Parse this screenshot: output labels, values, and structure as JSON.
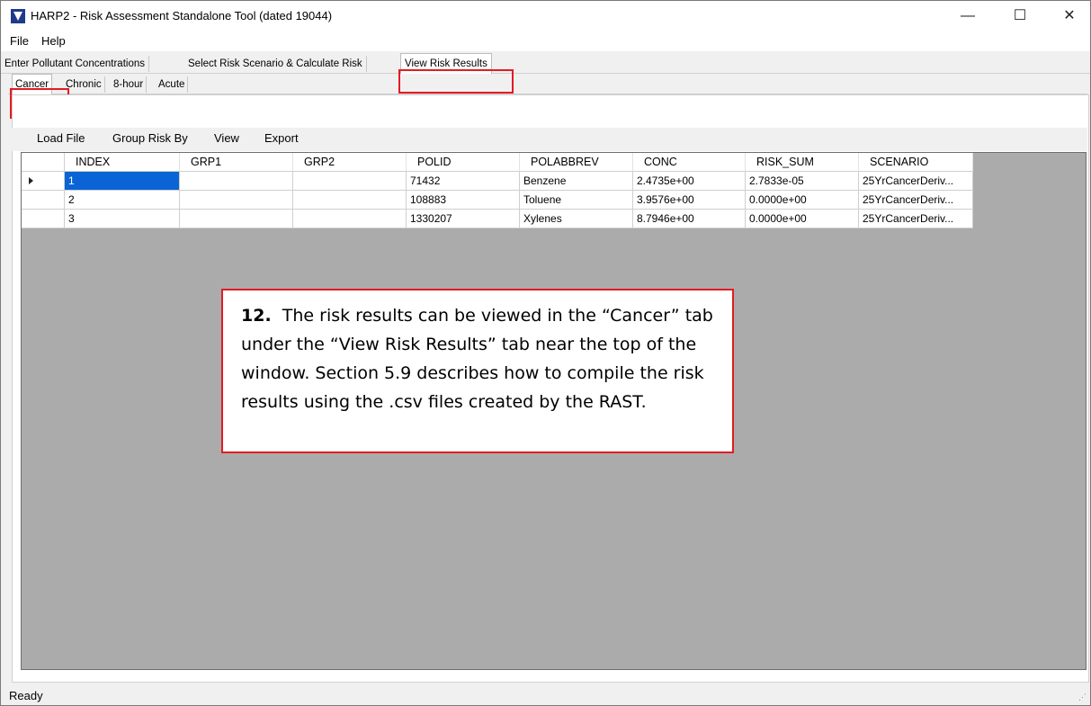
{
  "window": {
    "title": "HARP2 - Risk Assessment Standalone Tool (dated 19044)",
    "minimize_glyph": "—",
    "maximize_glyph": "☐",
    "close_glyph": "✕"
  },
  "menu": {
    "file": "File",
    "help": "Help"
  },
  "main_tabs": [
    "Enter Pollutant Concentrations",
    "Select Risk Scenario & Calculate Risk",
    "View Risk Results"
  ],
  "sub_tabs": [
    "Cancer",
    "Chronic",
    "8-hour",
    "Acute"
  ],
  "toolbar": {
    "load_file": "Load File",
    "group_risk_by": "Group Risk By",
    "view": "View",
    "export": "Export"
  },
  "table": {
    "columns": [
      "INDEX",
      "GRP1",
      "GRP2",
      "POLID",
      "POLABBREV",
      "CONC",
      "RISK_SUM",
      "SCENARIO"
    ],
    "rows": [
      [
        "1",
        "",
        "",
        "71432",
        "Benzene",
        "2.4735e+00",
        "2.7833e-05",
        "25YrCancerDeriv..."
      ],
      [
        "2",
        "",
        "",
        "108883",
        "Toluene",
        "3.9576e+00",
        "0.0000e+00",
        "25YrCancerDeriv..."
      ],
      [
        "3",
        "",
        "",
        "1330207",
        "Xylenes",
        "8.7946e+00",
        "0.0000e+00",
        "25YrCancerDeriv..."
      ]
    ]
  },
  "callout": {
    "number": "12.",
    "text": "The risk results can be viewed in the “Cancer” tab under the “View Risk Results” tab near the top of the window.  Section 5.9 describes how to compile the risk results using the .csv files created by the RAST."
  },
  "status": {
    "text": "Ready"
  },
  "colors": {
    "highlight": "#e31b23",
    "selection": "#0a64d6",
    "grid_background": "#ababab"
  }
}
